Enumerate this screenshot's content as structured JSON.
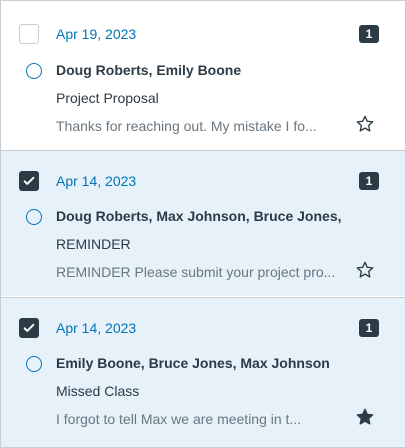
{
  "conversations": [
    {
      "selected": false,
      "date": "Apr 19, 2023",
      "count": "1",
      "participants": "Doug Roberts, Emily Boone",
      "subject": "Project Proposal",
      "preview": "Thanks for reaching out. My mistake I fo...",
      "starred": false
    },
    {
      "selected": true,
      "date": "Apr 14, 2023",
      "count": "1",
      "participants": "Doug Roberts, Max Johnson, Bruce Jones, ...",
      "subject": "REMINDER",
      "preview": "REMINDER Please submit your project pro...",
      "starred": false
    },
    {
      "selected": true,
      "date": "Apr 14, 2023",
      "count": "1",
      "participants": "Emily Boone, Bruce Jones, Max Johnson",
      "subject": "Missed Class",
      "preview": "I forgot to tell Max we are meeting in t...",
      "starred": true
    }
  ],
  "colors": {
    "accent": "#0374b5",
    "dark": "#2d3b45",
    "selected_bg": "#e6f1f9",
    "muted_text": "#6b7780"
  },
  "icons": {
    "checkbox_checked": "check-icon",
    "unread": "unread-indicator-icon",
    "star_empty": "star-outline-icon",
    "star_filled": "star-filled-icon"
  }
}
